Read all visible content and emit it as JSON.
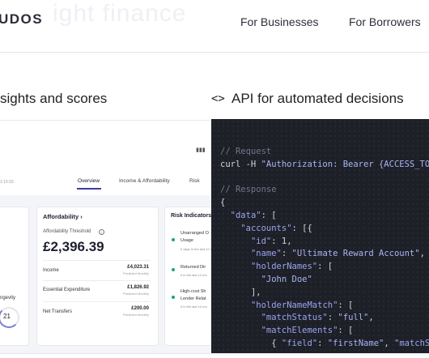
{
  "header": {
    "brand": "UDOS",
    "faded_text": "ight finance",
    "nav": [
      "For Businesses",
      "For Borrowers"
    ]
  },
  "sections": {
    "left_title": "sights and scores",
    "right_icon": "code-icon",
    "right_title": "API for automated decisions"
  },
  "dashboard": {
    "date": "3 15:33",
    "tabs": [
      "Overview",
      "Income & Affordability",
      "Risk"
    ],
    "active_tab": "Overview",
    "longevity_label": "ngevity",
    "longevity_score": "21",
    "affordability": {
      "title": "Affordability",
      "threshold_label": "Affordability Threshold",
      "threshold_value": "£2,396.39",
      "rows": [
        {
          "label": "Income",
          "value": "£4,023.31",
          "sub": "Predicted Monthly"
        },
        {
          "label": "Essential Expenditure",
          "value": "£1,826.92",
          "sub": "Predicted Monthly"
        },
        {
          "label": "Net Transfers",
          "value": "£200.00",
          "sub": "Predicted Monthly"
        }
      ]
    },
    "risk": {
      "title": "Risk Indicators",
      "items": [
        {
          "name": "Unarranged O",
          "name2": "Usage",
          "sub": "0 days in the last 12 mo"
        },
        {
          "name": "Returned Dir",
          "name2": "",
          "sub": "0 in the last 12 mo"
        },
        {
          "name": "High-cost Sh",
          "name2": "Lender Relat",
          "sub": "0 in the last 12 mo"
        }
      ]
    },
    "colors": {
      "accent": "#3b3f9e",
      "risk_dot": "#1ea37b"
    }
  },
  "code": {
    "request_comment": "// Request",
    "curl": "curl -H ",
    "auth_header": "\"Authorization: Bearer {ACCESS_TO",
    "response_comment": "// Response",
    "open_brace": "{",
    "data_key": "\"data\"",
    "data_open": ": [",
    "accounts_key": "\"accounts\"",
    "accounts_open": ": [{",
    "id_key": "\"id\"",
    "id_val": ": 1,",
    "name_key": "\"name\"",
    "name_colon": ": ",
    "name_val": "\"Ultimate Reward Account\"",
    "name_tail": ",",
    "holderNames_key": "\"holderNames\"",
    "holderNames_open": ": [",
    "holder_val": "\"John Doe\"",
    "holder_close": "],",
    "match_key": "\"holderNameMatch\"",
    "match_open": ": [",
    "status_key": "\"matchStatus\"",
    "status_colon": ": ",
    "status_val": "\"full\"",
    "status_tail": ",",
    "elements_key": "\"matchElements\"",
    "elements_open": ": [",
    "field_open": "{ ",
    "field_key": "\"field\"",
    "field_colon": ": ",
    "field_val": "\"firstName\"",
    "field_comma": ", ",
    "matchs_key": "\"matchS"
  }
}
